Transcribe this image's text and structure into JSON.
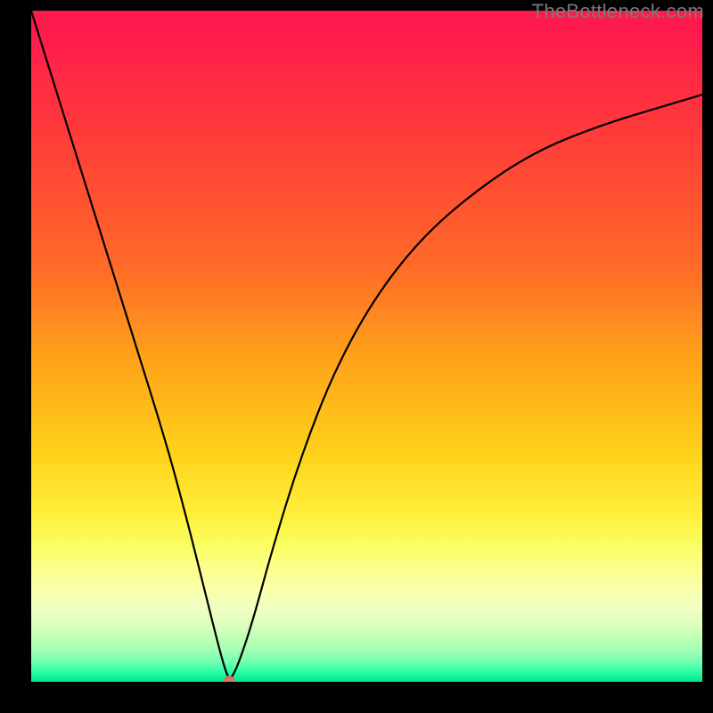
{
  "watermark": "TheBottleneck.com",
  "chart_data": {
    "type": "line",
    "title": "",
    "xlabel": "",
    "ylabel": "",
    "xlim": [
      0,
      100
    ],
    "ylim": [
      0,
      100
    ],
    "grid": false,
    "legend": false,
    "description": "Bottleneck curve with V-shaped minimum over rainbow heat gradient (green=good near bottom, red=bad near top).",
    "series": [
      {
        "name": "bottleneck-curve",
        "x": [
          0,
          5,
          10,
          15,
          20,
          23,
          26,
          28,
          29,
          29.5,
          30,
          31,
          33,
          36,
          40,
          45,
          51,
          58,
          66,
          75,
          85,
          95,
          100
        ],
        "y": [
          100,
          84,
          68,
          52,
          36,
          25,
          13,
          5,
          1.5,
          0.5,
          0.8,
          3,
          9,
          20,
          33,
          46,
          57,
          66,
          73,
          79,
          83,
          86,
          87.5
        ]
      }
    ],
    "marker": {
      "x": 29.5,
      "y": 0,
      "r": 0.9,
      "color": "#d07a60"
    },
    "background_gradient": {
      "type": "vertical",
      "stops": [
        {
          "pct": 0,
          "color": "#ff1a4d"
        },
        {
          "pct": 50,
          "color": "#ffa31a"
        },
        {
          "pct": 80,
          "color": "#fbff66"
        },
        {
          "pct": 100,
          "color": "#00e58c"
        }
      ]
    }
  }
}
